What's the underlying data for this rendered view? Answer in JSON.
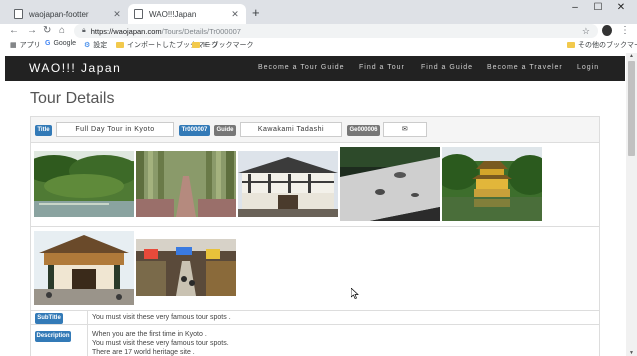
{
  "browser": {
    "tabs": [
      {
        "title": "waojapan-footter",
        "active": false
      },
      {
        "title": "WAO!!!Japan",
        "active": true
      }
    ],
    "new_tab_symbol": "+",
    "close_symbol": "✕",
    "window_controls": {
      "minimize": "–",
      "maximize": "☐",
      "close": "✕"
    },
    "url": {
      "host": "https://waojapan.com",
      "path": "/Tours/Details/Tr000007"
    },
    "bookmarks": [
      {
        "label": "アプリ",
        "icon": "apps-grid-icon"
      },
      {
        "label": "Google",
        "icon": "google-icon"
      },
      {
        "label": "設定",
        "icon": "gear-icon"
      },
      {
        "label": "インポートしたブックマーク",
        "icon": "folder-icon"
      },
      {
        "label": "IE ブックマーク",
        "icon": "folder-icon"
      }
    ],
    "other_bookmarks": "その他のブックマーク"
  },
  "site": {
    "brand": "WAO!!! Japan",
    "nav": [
      "Become a Tour Guide",
      "Find a Tour",
      "Find a Guide",
      "Become a Traveler",
      "Login"
    ]
  },
  "page": {
    "title": "Tour Details",
    "fields": {
      "title_label": "Title",
      "title_value": "Full Day Tour in Kyoto",
      "tour_id": "Tr000007",
      "guide_label": "Guide",
      "guide_value": "Kawakami Tadashi",
      "guide_id": "Ge000006",
      "mail_icon": "✉"
    },
    "photos": [
      {
        "name": "garden-pond-photo"
      },
      {
        "name": "bamboo-forest-photo"
      },
      {
        "name": "castle-building-photo"
      },
      {
        "name": "rock-garden-photo"
      },
      {
        "name": "golden-pavilion-photo"
      },
      {
        "name": "temple-gate-photo"
      },
      {
        "name": "shopping-arcade-photo"
      }
    ],
    "subtitle_label": "SubTitle",
    "subtitle_value": "You must visit these very famous tour spots .",
    "description_label": "Description",
    "description_lines": [
      "When you are the first time in Kyoto .",
      "You must visit these very famous tour spots.",
      "There are 17 world heritage site ."
    ]
  },
  "colors": {
    "navbar": "#222222",
    "label_primary": "#337ab7",
    "label_default": "#777777"
  }
}
